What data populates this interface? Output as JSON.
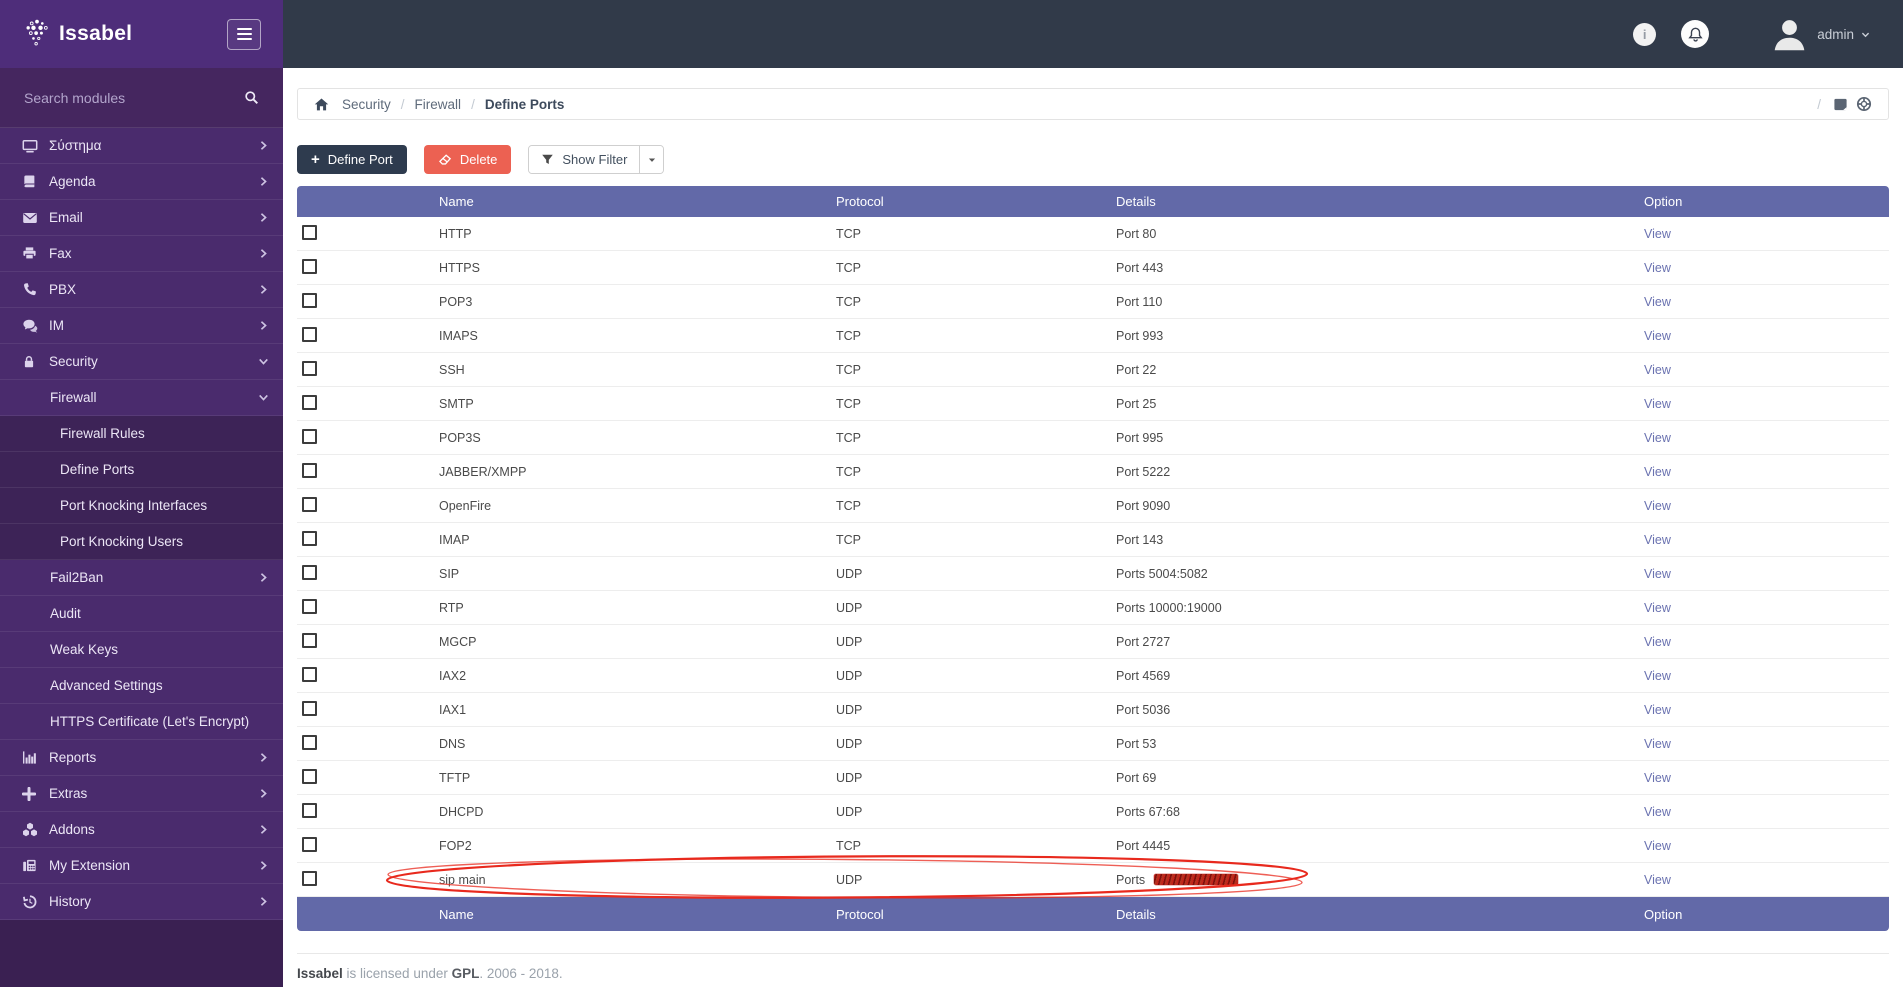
{
  "brand": {
    "logo_text": "Issabel"
  },
  "topbar": {
    "username": "admin",
    "info_icon": "i",
    "icons": [
      "info-icon",
      "bell-icon",
      "avatar"
    ]
  },
  "sidebar": {
    "search_placeholder": "Search modules",
    "items": [
      {
        "label": "Σύστημα",
        "icon": "desktop",
        "level": 0,
        "chevron": "right"
      },
      {
        "label": "Agenda",
        "icon": "book",
        "level": 0,
        "chevron": "right"
      },
      {
        "label": "Email",
        "icon": "envelope",
        "level": 0,
        "chevron": "right"
      },
      {
        "label": "Fax",
        "icon": "printer",
        "level": 0,
        "chevron": "right"
      },
      {
        "label": "PBX",
        "icon": "phone",
        "level": 0,
        "chevron": "right"
      },
      {
        "label": "IM",
        "icon": "comments",
        "level": 0,
        "chevron": "right"
      },
      {
        "label": "Security",
        "icon": "lock",
        "level": 0,
        "chevron": "down"
      },
      {
        "label": "Firewall",
        "level": 1,
        "chevron": "down"
      },
      {
        "label": "Firewall Rules",
        "level": 2
      },
      {
        "label": "Define Ports",
        "level": 2,
        "active": true
      },
      {
        "label": "Port Knocking Interfaces",
        "level": 2
      },
      {
        "label": "Port Knocking Users",
        "level": 2
      },
      {
        "label": "Fail2Ban",
        "level": 1,
        "chevron": "right"
      },
      {
        "label": "Audit",
        "level": 1
      },
      {
        "label": "Weak Keys",
        "level": 1
      },
      {
        "label": "Advanced Settings",
        "level": 1
      },
      {
        "label": "HTTPS Certificate (Let's Encrypt)",
        "level": 1
      },
      {
        "label": "Reports",
        "icon": "chart",
        "level": 0,
        "chevron": "right"
      },
      {
        "label": "Extras",
        "icon": "plus",
        "level": 0,
        "chevron": "right"
      },
      {
        "label": "Addons",
        "icon": "cubes",
        "level": 0,
        "chevron": "right"
      },
      {
        "label": "My Extension",
        "icon": "fax",
        "level": 0,
        "chevron": "right"
      },
      {
        "label": "History",
        "icon": "history",
        "level": 0,
        "chevron": "right"
      }
    ]
  },
  "breadcrumb": {
    "links": [
      "Security",
      "Firewall"
    ],
    "current": "Define Ports",
    "separator": "/"
  },
  "toolbar": {
    "define_port_label": "Define Port",
    "delete_label": "Delete",
    "show_filter_label": "Show Filter"
  },
  "table": {
    "headers": {
      "name": "Name",
      "protocol": "Protocol",
      "details": "Details",
      "option": "Option"
    },
    "view_label": "View",
    "rows": [
      {
        "name": "HTTP",
        "protocol": "TCP",
        "details": "Port 80"
      },
      {
        "name": "HTTPS",
        "protocol": "TCP",
        "details": "Port 443"
      },
      {
        "name": "POP3",
        "protocol": "TCP",
        "details": "Port 110"
      },
      {
        "name": "IMAPS",
        "protocol": "TCP",
        "details": "Port 993"
      },
      {
        "name": "SSH",
        "protocol": "TCP",
        "details": "Port 22"
      },
      {
        "name": "SMTP",
        "protocol": "TCP",
        "details": "Port 25"
      },
      {
        "name": "POP3S",
        "protocol": "TCP",
        "details": "Port 995"
      },
      {
        "name": "JABBER/XMPP",
        "protocol": "TCP",
        "details": "Port 5222"
      },
      {
        "name": "OpenFire",
        "protocol": "TCP",
        "details": "Port 9090"
      },
      {
        "name": "IMAP",
        "protocol": "TCP",
        "details": "Port 143"
      },
      {
        "name": "SIP",
        "protocol": "UDP",
        "details": "Ports 5004:5082"
      },
      {
        "name": "RTP",
        "protocol": "UDP",
        "details": "Ports 10000:19000"
      },
      {
        "name": "MGCP",
        "protocol": "UDP",
        "details": "Port 2727"
      },
      {
        "name": "IAX2",
        "protocol": "UDP",
        "details": "Port 4569"
      },
      {
        "name": "IAX1",
        "protocol": "UDP",
        "details": "Port 5036"
      },
      {
        "name": "DNS",
        "protocol": "UDP",
        "details": "Port 53"
      },
      {
        "name": "TFTP",
        "protocol": "UDP",
        "details": "Port 69"
      },
      {
        "name": "DHCPD",
        "protocol": "UDP",
        "details": "Ports 67:68"
      },
      {
        "name": "FOP2",
        "protocol": "TCP",
        "details": "Port 4445"
      },
      {
        "name": "sip main",
        "protocol": "UDP",
        "details": "Ports",
        "details_redacted": true,
        "annotated": true
      }
    ]
  },
  "annotation": {
    "shape": "hand-drawn ellipse",
    "color": "#e8291d",
    "circled_row": "sip main"
  },
  "footer": {
    "brand": "Issabel",
    "middle": " is licensed under ",
    "gpl": "GPL",
    "suffix": ". 2006 - 2018."
  },
  "colors": {
    "sidebar_purple": "#4a2b6d",
    "sidebar_submenu": "#3d2357",
    "topbar_dark": "#313a49",
    "table_header": "#6269a8",
    "delete_button": "#ec6152",
    "define_button": "#2e3b4e",
    "view_link": "#6a72b0",
    "annotation_red": "#e8291d"
  }
}
